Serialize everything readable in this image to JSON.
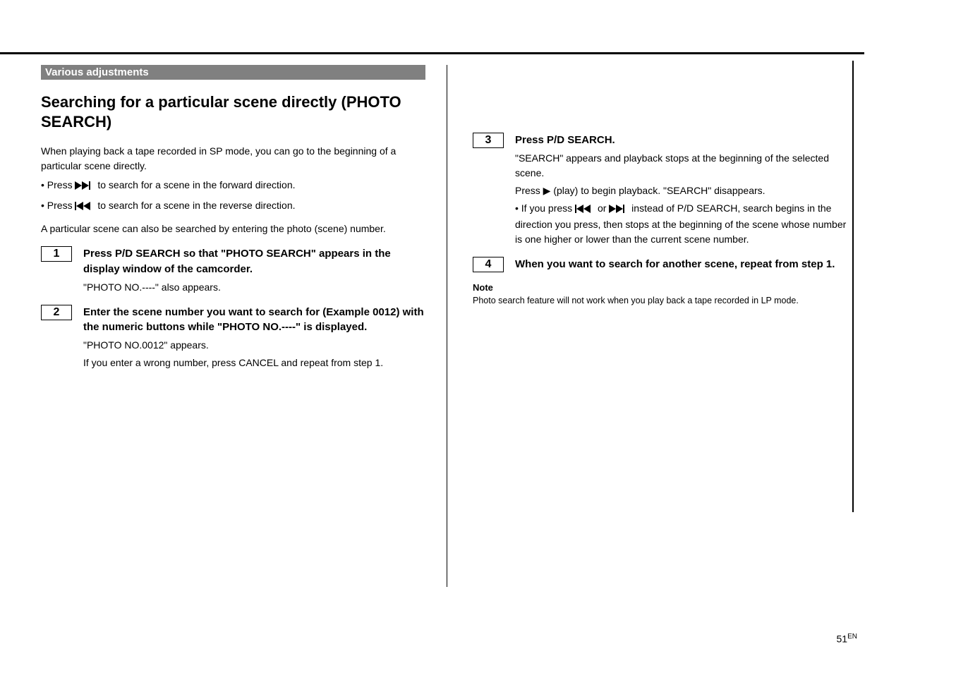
{
  "banner": "Various adjustments",
  "left": {
    "title": "Searching for a particular scene directly (PHOTO SEARCH)",
    "intro1": "When playing back a tape recorded in SP mode, you can go to the beginning of a particular scene directly.",
    "intro2_pre": "• Press ",
    "intro2_post": " to search for a scene in the forward direction.",
    "intro3_pre": "• Press ",
    "intro3_post": " to search for a scene in the reverse direction.",
    "intro4": "A particular scene can also be searched by entering the photo (scene) number.",
    "step1": {
      "num": "1",
      "lead": "Press P/D SEARCH so that \"PHOTO SEARCH\" appears in the display window of the camcorder.",
      "sub": "\"PHOTO NO.----\" also appears."
    },
    "step2": {
      "num": "2",
      "lead": "Enter the scene number you want to search for (Example 0012) with the numeric buttons while \"PHOTO NO.----\" is displayed.",
      "sub_a": "\"PHOTO NO.0012\" appears.",
      "sub_b": "If you enter a wrong number, press CANCEL and repeat from step 1."
    }
  },
  "right": {
    "step3": {
      "num": "3",
      "lead": "Press P/D SEARCH.",
      "sub_a": "\"SEARCH\" appears and playback stops at the beginning of the selected scene.",
      "sub_b": "Press ▶ (play) to begin playback. \"SEARCH\" disappears.",
      "sub_c_pre": "• If you press ",
      "sub_c_mid": " or ",
      "sub_c_post": " instead of P/D SEARCH, search begins in the direction you press, then stops at the beginning of the scene whose number is one higher or lower than the current scene number."
    },
    "step4": {
      "num": "4",
      "lead": "When you want to search for another scene, repeat from step 1."
    },
    "note_label": "Note",
    "note_body": "Photo search feature will not work when you play back a tape recorded in LP mode."
  },
  "pagenum": "51"
}
